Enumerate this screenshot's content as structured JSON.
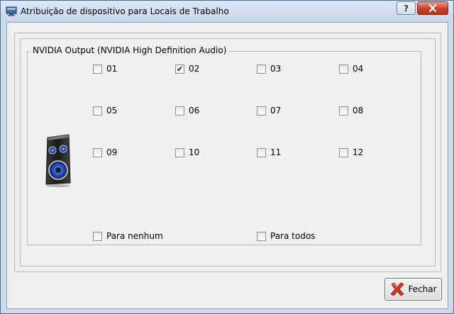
{
  "window": {
    "title": "Atribuição de dispositivo para Locais de Trabalho",
    "help_label": "?",
    "close_glyph": "✕"
  },
  "group": {
    "title": "NVIDIA Output (NVIDIA High Definition Audio)",
    "icon": "speaker-icon"
  },
  "workstations": [
    {
      "label": "01",
      "checked": false
    },
    {
      "label": "02",
      "checked": true
    },
    {
      "label": "03",
      "checked": false
    },
    {
      "label": "04",
      "checked": false
    },
    {
      "label": "05",
      "checked": false
    },
    {
      "label": "06",
      "checked": false
    },
    {
      "label": "07",
      "checked": false
    },
    {
      "label": "08",
      "checked": false
    },
    {
      "label": "09",
      "checked": false
    },
    {
      "label": "10",
      "checked": false
    },
    {
      "label": "11",
      "checked": false
    },
    {
      "label": "12",
      "checked": false
    }
  ],
  "options": {
    "none_label": "Para nenhum",
    "none_checked": false,
    "all_label": "Para todos",
    "all_checked": false
  },
  "footer": {
    "close_label": "Fechar",
    "close_icon": "red-x-icon"
  },
  "colors": {
    "close_button": "#c8452e",
    "title_bar": "#c9d8ea"
  }
}
